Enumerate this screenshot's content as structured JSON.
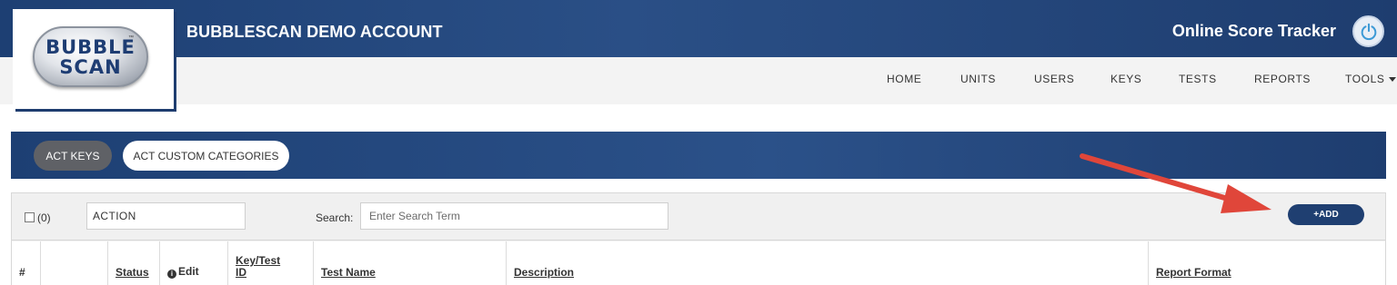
{
  "header": {
    "account_name": "BUBBLESCAN DEMO ACCOUNT",
    "tracker_title": "Online Score Tracker",
    "power_icon": "power-icon"
  },
  "logo": {
    "line1": "BUBBLE",
    "line2": "SCAN",
    "tm": "™"
  },
  "nav": {
    "items": [
      "HOME",
      "UNITS",
      "USERS",
      "KEYS",
      "TESTS",
      "REPORTS",
      "TOOLS"
    ]
  },
  "tabs": {
    "active": "ACT KEYS",
    "inactive": "ACT CUSTOM CATEGORIES"
  },
  "toolbar": {
    "selected_count": "(0)",
    "action_value": "ACTION",
    "search_label": "Search:",
    "search_placeholder": "Enter Search Term",
    "add_label": "+ADD"
  },
  "table": {
    "columns": [
      "#",
      "",
      "Status",
      "Edit",
      "Key/Test ID",
      "Test Name",
      "Description",
      "Report Format"
    ]
  },
  "colors": {
    "brand_navy": "#1f3f71",
    "annotation_arrow": "#e0463a"
  }
}
